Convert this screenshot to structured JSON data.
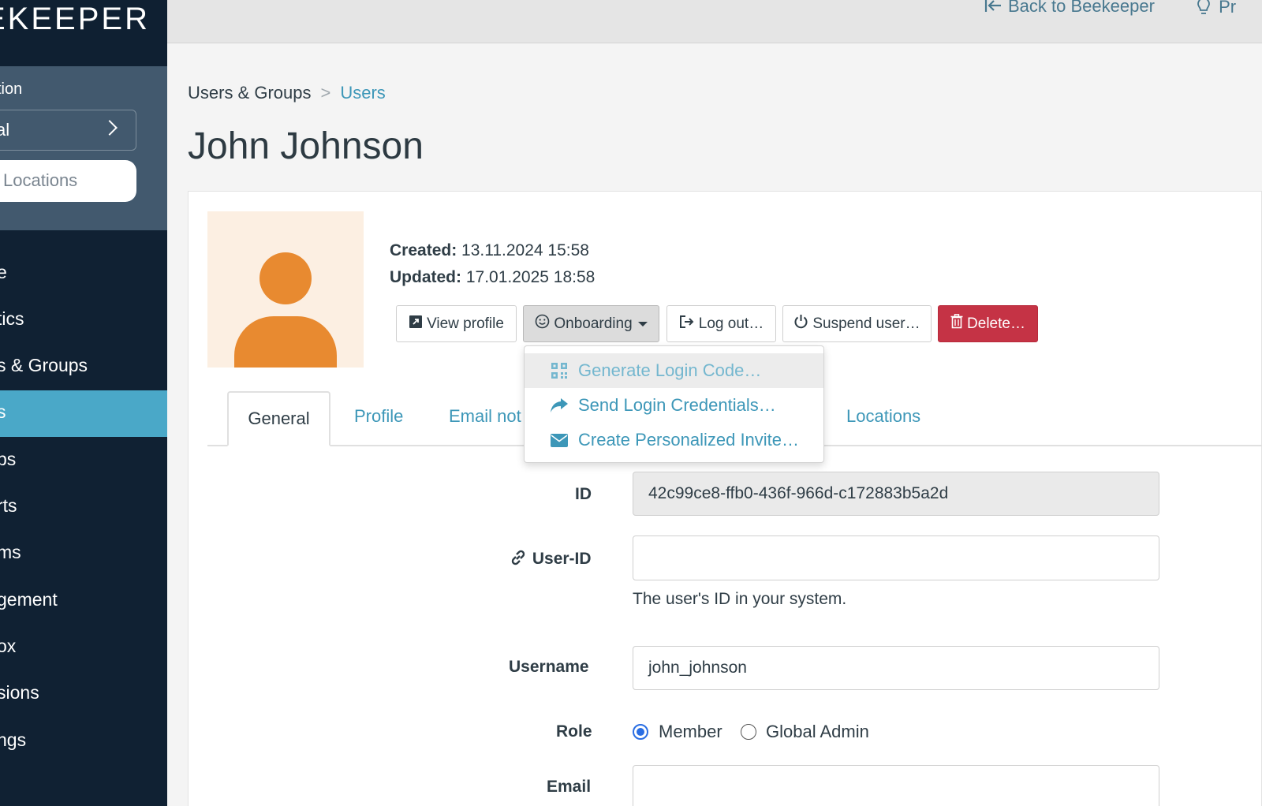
{
  "sidebar": {
    "logo": "EKEEPER",
    "org_label": "tion",
    "org_value": "al",
    "location_search": "Locations",
    "items": [
      {
        "label": "e"
      },
      {
        "label": "tics"
      },
      {
        "label": "s & Groups"
      },
      {
        "label": "s",
        "active": true
      },
      {
        "label": "ps"
      },
      {
        "label": "rts"
      },
      {
        "label": "ms"
      },
      {
        "label": "gement"
      },
      {
        "label": "ox"
      },
      {
        "label": "sions"
      },
      {
        "label": "ngs"
      }
    ]
  },
  "topbar": {
    "back_label": "Back to Beekeeper",
    "partial_label": "Pr"
  },
  "breadcrumb": {
    "parent": "Users & Groups",
    "separator": ">",
    "current": "Users"
  },
  "page_title": "John Johnson",
  "user": {
    "created_label": "Created:",
    "created_value": "13.11.2024 15:58",
    "updated_label": "Updated:",
    "updated_value": "17.01.2025 18:58"
  },
  "actions": {
    "view_profile": "View profile",
    "onboarding": "Onboarding",
    "log_out": "Log out…",
    "suspend": "Suspend user…",
    "delete": "Delete…"
  },
  "onboarding_menu": {
    "items": [
      {
        "label": "Generate Login Code…",
        "icon": "qr-code-icon"
      },
      {
        "label": "Send Login Credentials…",
        "icon": "share-arrow-icon"
      },
      {
        "label": "Create Personalized Invite…",
        "icon": "envelope-icon"
      }
    ]
  },
  "tabs": [
    {
      "label": "General",
      "active": true
    },
    {
      "label": "Profile"
    },
    {
      "label": "Email not"
    },
    {
      "label": "Locations"
    }
  ],
  "form": {
    "id_label": "ID",
    "id_value": "42c99ce8-ffb0-436f-966d-c172883b5a2d",
    "userid_label": "User-ID",
    "userid_value": "",
    "userid_help": "The user's ID in your system.",
    "username_label": "Username",
    "username_value": "john_johnson",
    "role_label": "Role",
    "role_options": [
      "Member",
      "Global Admin"
    ],
    "role_selected": "Member",
    "email_label": "Email"
  },
  "colors": {
    "sidebar_bg": "#102133",
    "sidebar_active": "#4aa8c8",
    "link": "#3d97b8",
    "danger": "#c53345",
    "avatar": "#e88a30"
  }
}
